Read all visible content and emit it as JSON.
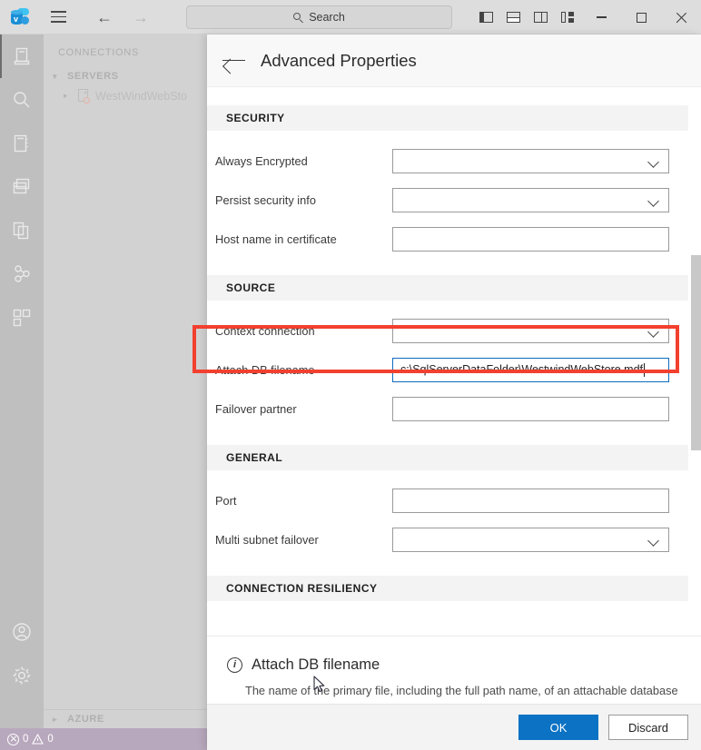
{
  "titlebar": {
    "logo_icon": "azure-data-studio-logo",
    "menu_icon": "hamburger-menu-icon",
    "back_icon": "back-arrow-icon",
    "forward_icon": "forward-arrow-icon",
    "search_placeholder": "Search",
    "search_icon": "search-icon",
    "layout_sidebar_icon": "toggle-primary-sidebar-icon",
    "layout_panel_icon": "toggle-panel-icon",
    "layout_secondary_icon": "toggle-secondary-sidebar-icon",
    "layout_custom_icon": "customize-layout-icon",
    "minimize_icon": "minimize-icon",
    "maximize_icon": "maximize-icon",
    "close_icon": "close-icon"
  },
  "activitybar": {
    "items": [
      {
        "name": "connections",
        "icon": "server-icon",
        "active": true
      },
      {
        "name": "search",
        "icon": "search-icon",
        "active": false
      },
      {
        "name": "notebooks",
        "icon": "notebook-icon",
        "active": false
      },
      {
        "name": "dashboard",
        "icon": "windows-panels-icon",
        "active": false
      },
      {
        "name": "projects",
        "icon": "copy-files-icon",
        "active": false
      },
      {
        "name": "source-control",
        "icon": "source-control-icon",
        "active": false
      },
      {
        "name": "extensions",
        "icon": "extensions-icon",
        "active": false
      }
    ],
    "bottom_items": [
      {
        "name": "accounts",
        "icon": "account-icon"
      },
      {
        "name": "manage",
        "icon": "gear-icon"
      }
    ]
  },
  "sidebar": {
    "title": "CONNECTIONS",
    "sections": [
      {
        "label": "SERVERS",
        "expanded": true,
        "chevron": "chevron-down-icon"
      },
      {
        "label": "AZURE",
        "expanded": false,
        "chevron": "chevron-right-icon"
      }
    ],
    "nodes": [
      {
        "label": "WestWindWebSto",
        "chevron": "chevron-right-icon",
        "icon": "server-node-icon"
      }
    ]
  },
  "statusbar": {
    "error_icon": "error-circle-icon",
    "error_count": "0",
    "warning_icon": "warning-triangle-icon",
    "warning_count": "0"
  },
  "dialog": {
    "back_icon": "back-arrow-icon",
    "title": "Advanced Properties",
    "sections": [
      {
        "heading": "SECURITY",
        "rows": [
          {
            "label": "Always Encrypted",
            "type": "select",
            "value": ""
          },
          {
            "label": "Persist security info",
            "type": "select",
            "value": ""
          },
          {
            "label": "Host name in certificate",
            "type": "text",
            "value": ""
          }
        ]
      },
      {
        "heading": "SOURCE",
        "rows": [
          {
            "label": "Context connection",
            "type": "select",
            "value": ""
          },
          {
            "label": "Attach DB filename",
            "type": "text",
            "value": "c:\\SqlServerDataFolder\\WestwindWebStore.mdf",
            "focused": true,
            "highlighted": true
          },
          {
            "label": "Failover partner",
            "type": "text",
            "value": ""
          }
        ]
      },
      {
        "heading": "GENERAL",
        "rows": [
          {
            "label": "Port",
            "type": "text",
            "value": ""
          },
          {
            "label": "Multi subnet failover",
            "type": "select",
            "value": ""
          }
        ]
      },
      {
        "heading": "CONNECTION RESILIENCY",
        "rows": []
      }
    ],
    "info": {
      "icon": "info-icon",
      "title": "Attach DB filename",
      "description": "The name of the primary file, including the full path name, of an attachable database"
    },
    "footer": {
      "ok_label": "OK",
      "discard_label": "Discard"
    }
  },
  "colors": {
    "accent_blue": "#0b72c4",
    "focus_border": "#0f6cbd",
    "highlight_red": "#f2402f",
    "statusbar_purple": "#b8a8bd",
    "activitybar_gray": "#bfbfbf",
    "sidebar_gray": "#d2d2d2",
    "titlebar_gray": "#dddddd"
  }
}
